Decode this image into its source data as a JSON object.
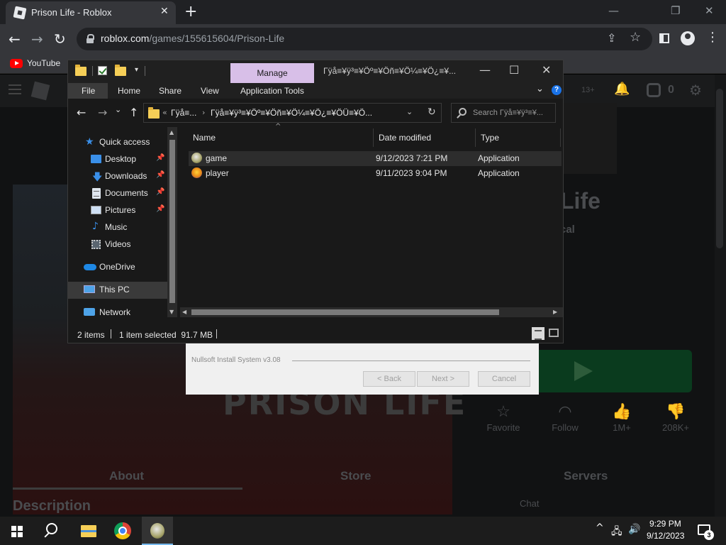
{
  "browser": {
    "tab_title": "Prison Life - Roblox",
    "tab_close": "✕",
    "new_tab": "+",
    "win_minimize": "—",
    "win_restore": "❐",
    "win_close": "✕",
    "nav_back": "←",
    "nav_forward": "→",
    "nav_reload": "↻",
    "url_host": "roblox.com",
    "url_path": "/games/155615604/Prison-Life",
    "share_icon": "⇪",
    "star_icon": "☆",
    "menu_icon": "⋮",
    "bookmarks": [
      {
        "label": "YouTube"
      }
    ]
  },
  "roblox_page": {
    "game_title": "Life",
    "creator_suffix": "cal",
    "banner_text": "PRISON LIFE",
    "stats": [
      {
        "label": "Favorite",
        "icon": "☆"
      },
      {
        "label": "Follow",
        "icon": "◠"
      },
      {
        "label": "1M+",
        "icon": "👍"
      },
      {
        "label": "208K+",
        "icon": "👎"
      }
    ],
    "tabs": [
      "About",
      "Store",
      "Servers"
    ],
    "section_heading": "Description",
    "chat_label": "Chat",
    "topbar_badge": "13+",
    "topbar_robux": "0"
  },
  "installer": {
    "label": "Nullsoft Install System v3.08",
    "back_btn": "< Back",
    "next_btn": "Next >",
    "cancel_btn": "Cancel"
  },
  "explorer": {
    "ribbon_context_tab": "Manage",
    "window_title": "Γÿå≡¥ÿ³≡¥Öº≡¥Öñ≡¥Ö¼≡¥Ö¿≡¥...",
    "win_minimize": "—",
    "win_maximize": "☐",
    "win_close": "✕",
    "ribbon_tabs": [
      "File",
      "Home",
      "Share",
      "View",
      "Application Tools"
    ],
    "ribbon_chevron": "⌄",
    "help": "?",
    "nav_back": "←",
    "nav_forward": "→",
    "nav_recent": "⌄",
    "nav_up": "↑",
    "address_parent": "Γÿå≡...",
    "address_current": "Γÿå≡¥ÿ³≡¥Öº≡¥Öñ≡¥Ö¼≡¥Ö¿≡¥ÖÜ≡¥Ö...",
    "address_overflow": "«",
    "address_chevron": "›",
    "address_dropdown": "⌄",
    "address_refresh": "↻",
    "search_placeholder": "Search Γÿå≡¥ÿ³≡¥...",
    "nav_pane": [
      {
        "label": "Quick access",
        "icon": "star-icon",
        "pinned": false
      },
      {
        "label": "Desktop",
        "icon": "desktop-icon",
        "pinned": true
      },
      {
        "label": "Downloads",
        "icon": "downloads-icon",
        "pinned": true
      },
      {
        "label": "Documents",
        "icon": "documents-icon",
        "pinned": true
      },
      {
        "label": "Pictures",
        "icon": "pictures-icon",
        "pinned": true
      },
      {
        "label": "Music",
        "icon": "music-icon",
        "pinned": false
      },
      {
        "label": "Videos",
        "icon": "videos-icon",
        "pinned": false
      },
      {
        "label": "OneDrive",
        "icon": "onedrive-icon",
        "pinned": false
      },
      {
        "label": "This PC",
        "icon": "this-pc-icon",
        "pinned": false,
        "selected": true
      },
      {
        "label": "Network",
        "icon": "network-icon",
        "pinned": false
      }
    ],
    "pin_glyph": "📌",
    "columns": [
      "Name",
      "Date modified",
      "Type"
    ],
    "sort_glyph": "^",
    "files": [
      {
        "name": "game",
        "date": "9/12/2023 7:21 PM",
        "type": "Application",
        "selected": true
      },
      {
        "name": "player",
        "date": "9/11/2023 9:04 PM",
        "type": "Application",
        "selected": false
      }
    ],
    "status": {
      "item_count": "2 items",
      "selection": "1 item selected  91.7 MB"
    }
  },
  "taskbar": {
    "tray_chevron": "^",
    "tray_network": "🖧",
    "tray_volume": "🔊",
    "clock_time": "9:29 PM",
    "clock_date": "9/12/2023",
    "notification_count": "3"
  }
}
